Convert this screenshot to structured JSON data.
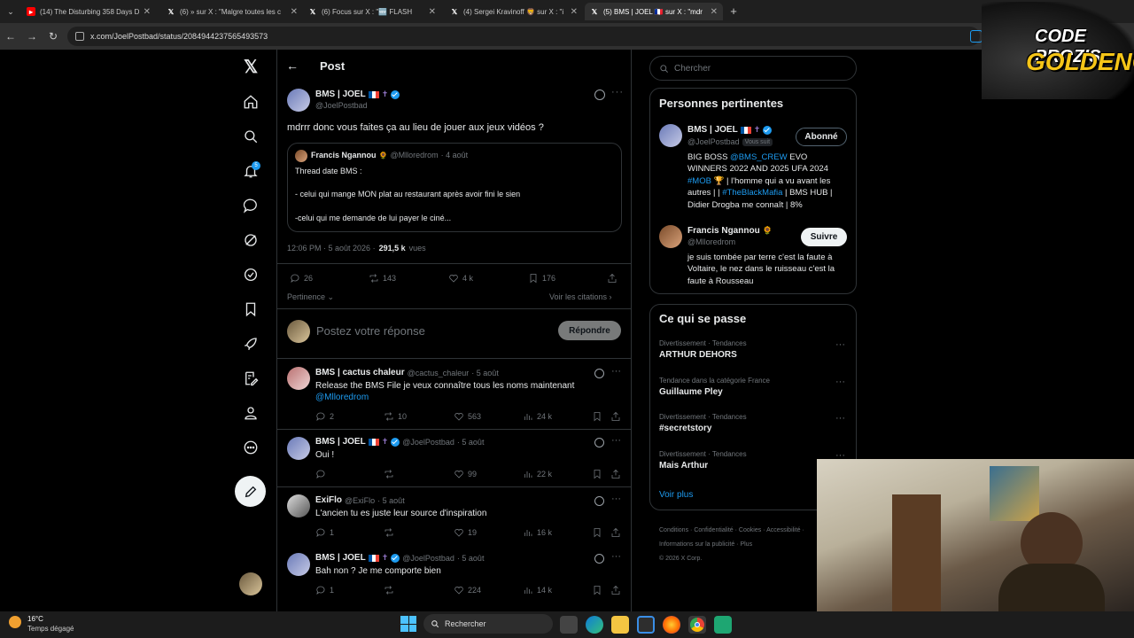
{
  "browser": {
    "tabs": [
      {
        "title": "(14) The Disturbing 358 Days D",
        "icon": "youtube-icon"
      },
      {
        "title": "(6) » sur X : \"Malgre toutes les c",
        "icon": "x-logo-icon"
      },
      {
        "title": "(6) Focus sur X : \"🆕 FLASH",
        "icon": "x-logo-icon"
      },
      {
        "title": "(4) Sergei Kravinoff 🦁 sur X : \"i",
        "icon": "x-logo-icon"
      },
      {
        "title": "(5) BMS | JOEL 🇫🇷 sur X : \"mdr",
        "icon": "x-logo-icon"
      }
    ],
    "url": "x.com/JoelPostbad/status/2084944237565493573"
  },
  "overlay": {
    "line1": "CODE PROZIS",
    "line2": "GOLDENG"
  },
  "nav": {
    "notif_count": "5"
  },
  "header": {
    "back": "←",
    "title": "Post"
  },
  "post": {
    "name": "BMS | JOEL",
    "handle": "@JoelPostbad",
    "text": "mdrrr donc vous faites ça au lieu de jouer aux jeux vidéos ?",
    "quote": {
      "name": "Francis Ngannou",
      "handle": "@Mlloredrom",
      "date": "· 4 août",
      "line1": "Thread date BMS :",
      "line2": "- celui qui mange MON plat au restaurant après avoir fini le sien",
      "line3": "-celui qui me demande de lui payer le ciné..."
    },
    "meta_time": "12:06 PM · 5 août 2026 ·",
    "views": "291,5 k",
    "views_label": "vues",
    "replies": "26",
    "reposts": "143",
    "likes": "4 k",
    "bookmarks": "176",
    "sort": "Pertinence",
    "quotes_link": "Voir les citations"
  },
  "composer": {
    "placeholder": "Postez votre réponse",
    "button": "Répondre"
  },
  "replies": [
    {
      "name": "BMS | cactus chaleur",
      "handle": "@cactus_chaleur",
      "date": "· 5 août",
      "text": "Release the BMS File je veux connaître tous les noms maintenant",
      "mention": "@Mlloredrom",
      "replies": "2",
      "reposts": "10",
      "likes": "563",
      "views": "24 k"
    },
    {
      "name": "BMS | JOEL",
      "handle": "@JoelPostbad",
      "date": "· 5 août",
      "text": "Oui !",
      "replies": "",
      "reposts": "",
      "likes": "99",
      "views": "22 k"
    },
    {
      "name": "ExiFlo",
      "handle": "@ExiFlo",
      "date": "· 5 août",
      "text": "L'ancien tu es juste leur source d'inspiration",
      "replies": "1",
      "reposts": "",
      "likes": "19",
      "views": "16 k"
    },
    {
      "name": "BMS | JOEL",
      "handle": "@JoelPostbad",
      "date": "· 5 août",
      "text": "Bah non ? Je me comporte bien",
      "replies": "1",
      "reposts": "",
      "likes": "224",
      "views": "14 k"
    }
  ],
  "search": {
    "placeholder": "Chercher"
  },
  "relevant": {
    "title": "Personnes pertinentes",
    "people": [
      {
        "name": "BMS | JOEL",
        "handle": "@JoelPostbad",
        "badge": "Vous suit",
        "button": "Abonné",
        "bio_a": "BIG BOSS ",
        "bio_link1": "@BMS_CREW",
        "bio_b": " EVO WINNERS 2022 AND 2025 UFA 2024 ",
        "bio_link2": "#MOB",
        "bio_c": " 🏆 | l'homme qui a vu avant les autres | | ",
        "bio_link3": "#TheBlackMafia",
        "bio_d": " | BMS HUB | Didier Drogba me connaît | 8%"
      },
      {
        "name": "Francis Ngannou",
        "handle": "@Mlloredrom",
        "button": "Suivre",
        "bio": "je suis tombée par terre c'est la faute à Voltaire, le nez dans le ruisseau c'est la faute à Rousseau"
      }
    ]
  },
  "trends": {
    "title": "Ce qui se passe",
    "items": [
      {
        "context": "Divertissement · Tendances",
        "name": "ARTHUR DEHORS"
      },
      {
        "context": "Tendance dans la catégorie France",
        "name": "Guillaume Pley"
      },
      {
        "context": "Divertissement · Tendances",
        "name": "#secretstory"
      },
      {
        "context": "Divertissement · Tendances",
        "name": "Mais Arthur"
      }
    ],
    "more": "Voir plus"
  },
  "footer": {
    "links": [
      "Conditions",
      "Confidentialité",
      "Cookies",
      "Accessibilité",
      "Informations sur la publicité",
      "Plus"
    ],
    "copyright": "© 2026 X Corp."
  },
  "taskbar": {
    "temp": "16°C",
    "weather": "Temps dégagé",
    "search": "Rechercher"
  },
  "colors": {
    "accent": "#1d9bf0",
    "background": "#000000",
    "border": "#2f3336",
    "muted": "#71767b"
  }
}
